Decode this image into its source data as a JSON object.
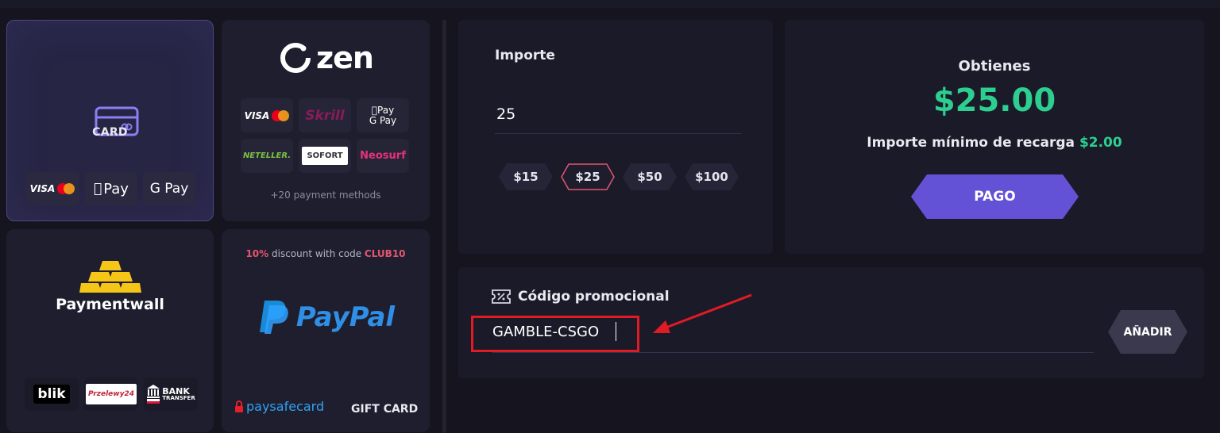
{
  "methods": {
    "card": {
      "label": "CARD",
      "chips": [
        "VISA",
        "Pay",
        "G Pay"
      ]
    },
    "zen": {
      "logo": "zen",
      "chips": [
        "VISA",
        "Skrill",
        "Pay",
        "G Pay",
        "NETELLER.",
        "SOFORT",
        "Neosurf"
      ],
      "more": "+20 payment methods"
    },
    "paymentwall": {
      "logo": "Paymentwall",
      "chips": [
        "blik",
        "Przelewy24",
        "BANK",
        "TRANSFER"
      ]
    },
    "paypal": {
      "discount_prefix": "10%",
      "discount_text": " discount with code ",
      "discount_code": "CLUB10",
      "logo": "PayPal",
      "paysafe": "paysafecard",
      "gift": "GIFT CARD"
    }
  },
  "amount": {
    "label": "Importe",
    "value": "25",
    "presets": [
      "$15",
      "$25",
      "$50",
      "$100"
    ],
    "selected_index": 1
  },
  "summary": {
    "label": "Obtienes",
    "total": "$25.00",
    "min_label": "Importe mínimo de recarga",
    "min_value": "$2.00",
    "pay_label": "PAGO"
  },
  "promo": {
    "label": "Código promocional",
    "value": "GAMBLE-CSGO",
    "add_label": "AÑADIR"
  },
  "colors": {
    "accent_green": "#2ccf8f",
    "accent_purple": "#6452d6",
    "highlight_red": "#e01b24",
    "selected_preset": "#e2566f",
    "background": "#15141f"
  }
}
